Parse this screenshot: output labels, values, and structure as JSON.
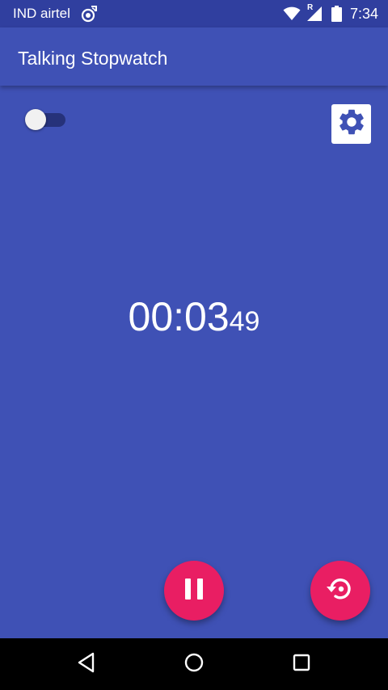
{
  "status_bar": {
    "carrier": "IND airtel",
    "time": "7:34",
    "roaming_indicator": "R",
    "icons": [
      "carrier-notification-icon",
      "wifi-icon",
      "signal-icon",
      "battery-icon"
    ]
  },
  "app_bar": {
    "title": "Talking Stopwatch"
  },
  "controls": {
    "toggle_on": false,
    "settings_icon": "gear-icon"
  },
  "timer": {
    "main": "00:03",
    "centiseconds": "49"
  },
  "fabs": {
    "pause_icon": "pause-icon",
    "reset_icon": "reset-icon"
  },
  "nav_bar": {
    "icons": [
      "back-icon",
      "home-icon",
      "recents-icon"
    ]
  },
  "colors": {
    "primary": "#3F51B5",
    "primary_dark": "#303F9F",
    "accent": "#E91E63",
    "nav_bar": "#000000"
  }
}
